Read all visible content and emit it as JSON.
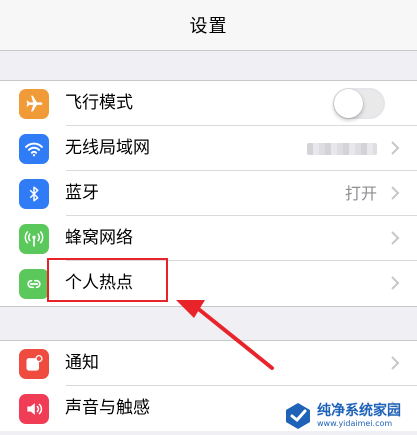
{
  "nav": {
    "title": "设置"
  },
  "group1": [
    {
      "label": "飞行模式",
      "icon": "airplane-icon",
      "color": "#f19a38",
      "control": "toggle",
      "toggle_on": false
    },
    {
      "label": "无线局域网",
      "icon": "wifi-icon",
      "color": "#2f7cf6",
      "control": "blurred-value"
    },
    {
      "label": "蓝牙",
      "icon": "bluetooth-icon",
      "color": "#2f7cf6",
      "value": "打开"
    },
    {
      "label": "蜂窝网络",
      "icon": "cellular-icon",
      "color": "#5ac85a"
    },
    {
      "label": "个人热点",
      "icon": "hotspot-icon",
      "color": "#5ac85a",
      "highlighted": true
    }
  ],
  "group2": [
    {
      "label": "通知",
      "icon": "notification-icon",
      "color": "#f04b3f"
    },
    {
      "label": "声音与触感",
      "icon": "sound-icon",
      "color": "#f03c55"
    }
  ],
  "watermark": {
    "title": "纯净系统家园",
    "url": "www.yidaimei.com"
  },
  "colors": {
    "highlight": "#e8242a",
    "chevron": "#c7c7cc",
    "background": "#efeff4"
  }
}
